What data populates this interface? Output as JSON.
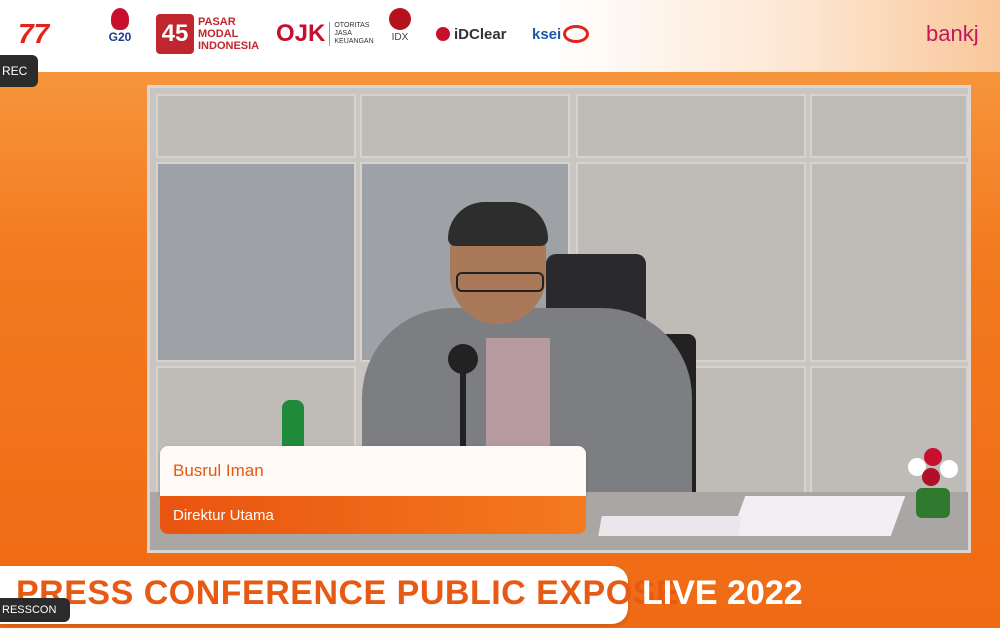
{
  "rec_badge": "REC",
  "presscon_badge": "RESSCON",
  "logos": {
    "logo_77": "77",
    "g20": "G20",
    "pasar_modal": "PASAR MODAL INDONESIA",
    "pasar_45": "45",
    "ojk": "OJK",
    "ojk_sub": "OTORITAS JASA KEUANGAN",
    "idx": "IDX",
    "idclear": "iDClear",
    "ksei": "ksei",
    "bank": "bankj"
  },
  "speaker": {
    "name": "Busrul Iman",
    "title": "Direktur Utama"
  },
  "banner": {
    "main": "PRESS CONFERENCE  PUBLIC EXPOSE",
    "live": "LIVE 2022"
  },
  "colors": {
    "accent": "#f47a1f",
    "name_text": "#e25a12",
    "brand_red": "#c8102e"
  }
}
